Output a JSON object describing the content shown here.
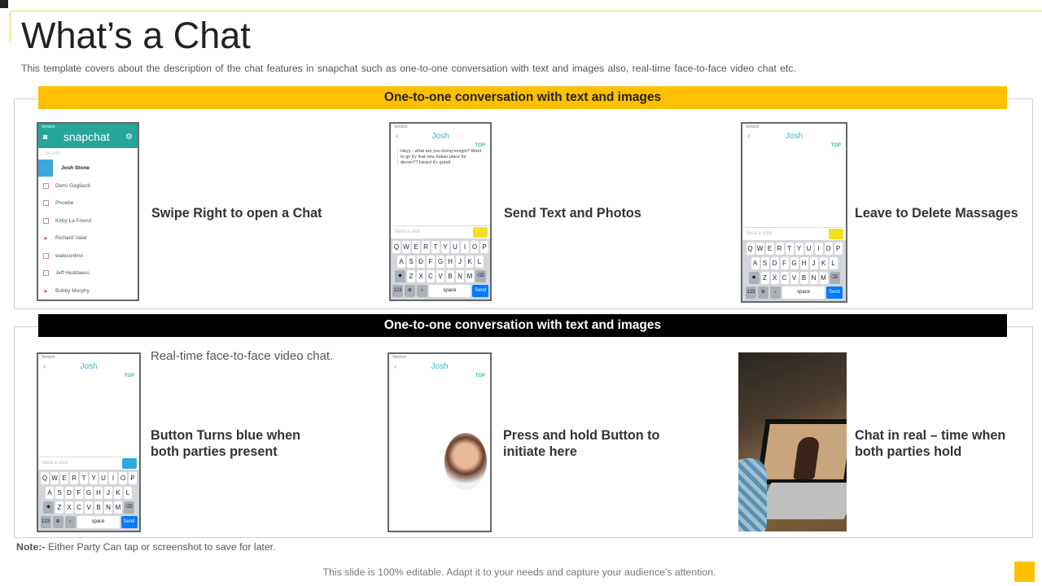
{
  "header": {
    "title": "What’s a Chat",
    "subtitle": "This template covers about the description of the chat features in snapchat such as one-to-one  conversation  with text and images also, real-time face-to-face  video chat etc."
  },
  "section1": {
    "banner": "One-to-one conversation with text and images",
    "items": [
      {
        "label": "Swipe Right to open a Chat"
      },
      {
        "label": "Send Text and Photos"
      },
      {
        "label": "Leave to Delete Massages"
      }
    ]
  },
  "section2": {
    "banner": "One-to-one conversation with text and images",
    "intro": "Real-time face-to-face video chat.",
    "items": [
      {
        "label": "Button Turns blue when both parties present"
      },
      {
        "label": "Press and hold Button to initiate here"
      },
      {
        "label": "Chat in real – time when both parties hold"
      }
    ]
  },
  "phone_ui": {
    "carrier": "Verizon",
    "app_name": "snapchat",
    "search": "Search",
    "contacts": [
      "Josh Stone",
      "Demi Gagliardi",
      "Phoebe",
      "Kirby La Friend",
      "Richard Valar",
      "walesonline",
      "Jeff Heddaeus",
      "Bobby Murphy"
    ],
    "contact_name": "Josh",
    "top_label": "TOP",
    "message": "Heyy - what are you doing tonight? Want to go try that new Italian place for dinner?? Heard it's great!",
    "send_placeholder": "Send a chat",
    "keyboard": [
      [
        "Q",
        "W",
        "E",
        "R",
        "T",
        "Y",
        "U",
        "I",
        "O",
        "P"
      ],
      [
        "A",
        "S",
        "D",
        "F",
        "G",
        "H",
        "J",
        "K",
        "L"
      ],
      [
        "Z",
        "X",
        "C",
        "V",
        "B",
        "N",
        "M"
      ]
    ],
    "space": "space",
    "send": "Send",
    "num": "123"
  },
  "note": {
    "label": "Note:-",
    "text": " Either Party Can tap or screenshot to save for later."
  },
  "footer": {
    "text": "This slide is 100% editable. Adapt it to your needs and capture your audience's attention."
  },
  "colors": {
    "accent": "#ffc000",
    "snap_green": "#26a69a",
    "send_yellow": "#f4e01c",
    "send_blue": "#2eaadc"
  }
}
